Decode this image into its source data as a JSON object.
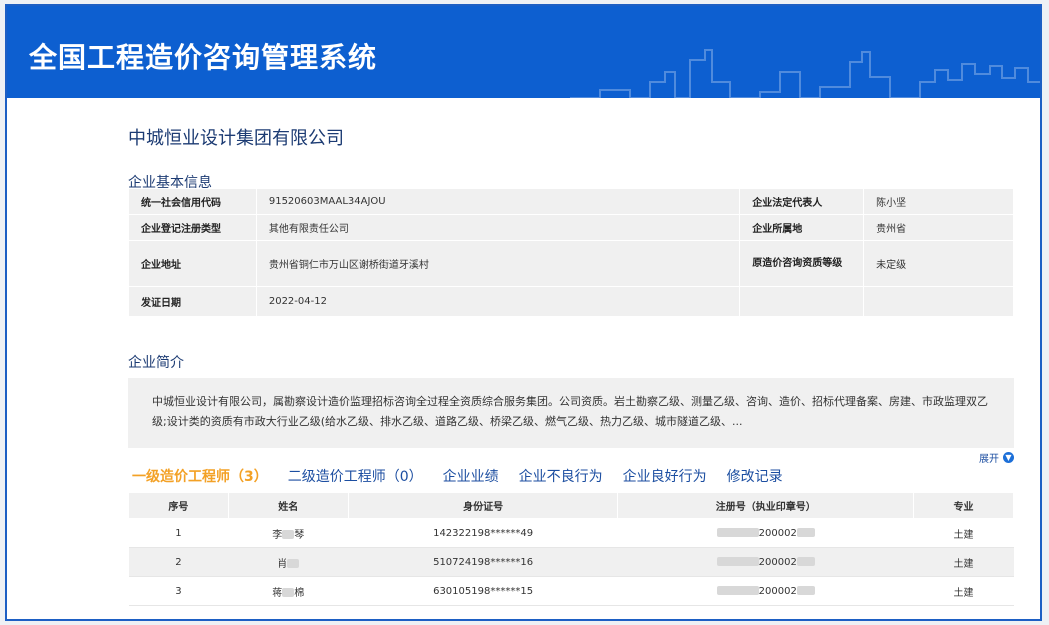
{
  "app": {
    "title": "全国工程造价咨询管理系统"
  },
  "company": {
    "name": "中城恒业设计集团有限公司"
  },
  "basic_info": {
    "section_title": "企业基本信息",
    "rows": [
      {
        "l1": "统一社会信用代码",
        "v1": "91520603MAAL34AJOU",
        "l2": "企业法定代表人",
        "v2": "陈小坚"
      },
      {
        "l1": "企业登记注册类型",
        "v1": "其他有限责任公司",
        "l2": "企业所属地",
        "v2": "贵州省"
      },
      {
        "l1": "企业地址",
        "v1": "贵州省铜仁市万山区谢桥街道牙溪村",
        "l2": "原造价咨询资质等级",
        "v2": "未定级"
      },
      {
        "l1": "发证日期",
        "v1": "2022-04-12",
        "l2": "",
        "v2": ""
      }
    ]
  },
  "intro": {
    "section_title": "企业简介",
    "text": "中城恒业设计有限公司，属勘察设计造价监理招标咨询全过程全资质综合服务集团。公司资质。岩土勘察乙级、测量乙级、咨询、造价、招标代理备案、房建、市政监理双乙级;设计类的资质有市政大行业乙级(给水乙级、排水乙级、道路乙级、桥梁乙级、燃气乙级、热力乙级、城市隧道乙级、...",
    "expand_label": "展开"
  },
  "tabs": [
    {
      "label": "一级造价工程师（3）",
      "active": true
    },
    {
      "label": "二级造价工程师（0）",
      "active": false
    },
    {
      "label": "企业业绩",
      "active": false
    },
    {
      "label": "企业不良行为",
      "active": false
    },
    {
      "label": "企业良好行为",
      "active": false
    },
    {
      "label": "修改记录",
      "active": false
    }
  ],
  "engineers": {
    "columns": [
      "序号",
      "姓名",
      "身份证号",
      "注册号（执业印章号）",
      "专业"
    ],
    "rows": [
      {
        "no": "1",
        "name_a": "李",
        "name_b": "琴",
        "id": "142322198******49",
        "reg": "200002",
        "major": "土建"
      },
      {
        "no": "2",
        "name_a": "肖",
        "name_b": "",
        "id": "510724198******16",
        "reg": "200002",
        "major": "土建"
      },
      {
        "no": "3",
        "name_a": "蒋",
        "name_b": "棉",
        "id": "630105198******15",
        "reg": "200002",
        "major": "土建"
      }
    ]
  },
  "colors": {
    "header": "#0d5fd0",
    "accent": "#f3a126",
    "link": "#1c4ea1"
  }
}
